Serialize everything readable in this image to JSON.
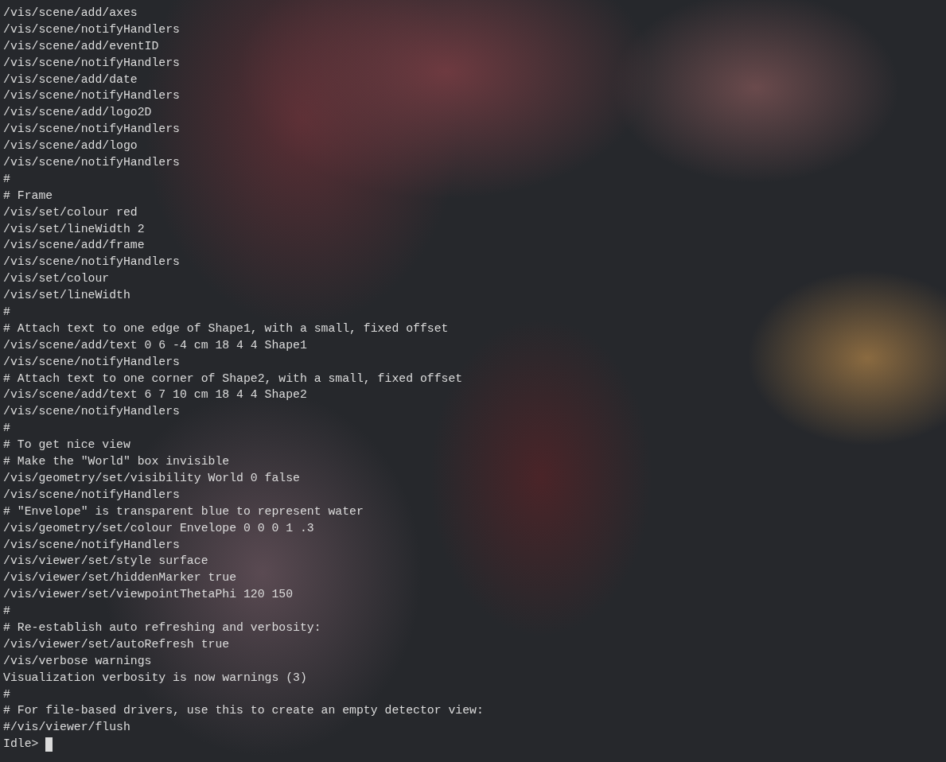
{
  "lines": [
    "/vis/scene/add/axes",
    "/vis/scene/notifyHandlers",
    "/vis/scene/add/eventID",
    "/vis/scene/notifyHandlers",
    "/vis/scene/add/date",
    "/vis/scene/notifyHandlers",
    "/vis/scene/add/logo2D",
    "/vis/scene/notifyHandlers",
    "/vis/scene/add/logo",
    "/vis/scene/notifyHandlers",
    "#",
    "# Frame",
    "/vis/set/colour red",
    "/vis/set/lineWidth 2",
    "/vis/scene/add/frame",
    "/vis/scene/notifyHandlers",
    "/vis/set/colour",
    "/vis/set/lineWidth",
    "#",
    "# Attach text to one edge of Shape1, with a small, fixed offset",
    "/vis/scene/add/text 0 6 -4 cm 18 4 4 Shape1",
    "/vis/scene/notifyHandlers",
    "# Attach text to one corner of Shape2, with a small, fixed offset",
    "/vis/scene/add/text 6 7 10 cm 18 4 4 Shape2",
    "/vis/scene/notifyHandlers",
    "#",
    "# To get nice view",
    "# Make the \"World\" box invisible",
    "/vis/geometry/set/visibility World 0 false",
    "/vis/scene/notifyHandlers",
    "# \"Envelope\" is transparent blue to represent water",
    "/vis/geometry/set/colour Envelope 0 0 0 1 .3",
    "/vis/scene/notifyHandlers",
    "/vis/viewer/set/style surface",
    "/vis/viewer/set/hiddenMarker true",
    "/vis/viewer/set/viewpointThetaPhi 120 150",
    "#",
    "# Re-establish auto refreshing and verbosity:",
    "/vis/viewer/set/autoRefresh true",
    "/vis/verbose warnings",
    "Visualization verbosity is now warnings (3)",
    "#",
    "# For file-based drivers, use this to create an empty detector view:",
    "#/vis/viewer/flush"
  ],
  "prompt": "Idle>"
}
